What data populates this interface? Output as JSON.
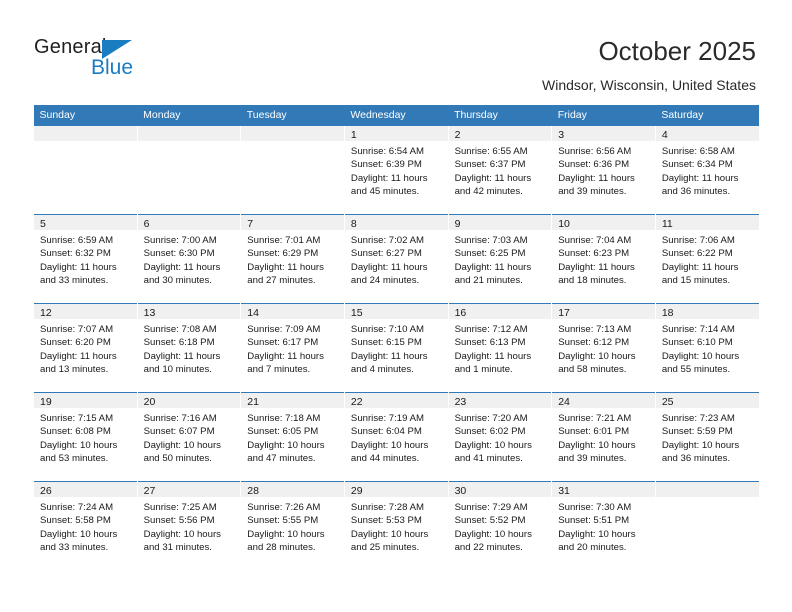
{
  "logo": {
    "word_dark": "General",
    "word_blue": "Blue",
    "triangle_color": "#1b7dc1"
  },
  "header": {
    "title": "October 2025",
    "subtitle": "Windsor, Wisconsin, United States",
    "accent_color": "#3279b7",
    "band_color": "#f0f0f0"
  },
  "weekday_headers": [
    "Sunday",
    "Monday",
    "Tuesday",
    "Wednesday",
    "Thursday",
    "Friday",
    "Saturday"
  ],
  "labels": {
    "sunrise_prefix": "Sunrise:",
    "sunset_prefix": "Sunset:",
    "daylight_prefix": "Daylight:"
  },
  "weeks": [
    [
      {
        "day": "",
        "sunrise": "",
        "sunset": "",
        "daylight": "",
        "empty": true
      },
      {
        "day": "",
        "sunrise": "",
        "sunset": "",
        "daylight": "",
        "empty": true
      },
      {
        "day": "",
        "sunrise": "",
        "sunset": "",
        "daylight": "",
        "empty": true
      },
      {
        "day": "1",
        "sunrise": "Sunrise: 6:54 AM",
        "sunset": "Sunset: 6:39 PM",
        "daylight": "Daylight: 11 hours and 45 minutes."
      },
      {
        "day": "2",
        "sunrise": "Sunrise: 6:55 AM",
        "sunset": "Sunset: 6:37 PM",
        "daylight": "Daylight: 11 hours and 42 minutes."
      },
      {
        "day": "3",
        "sunrise": "Sunrise: 6:56 AM",
        "sunset": "Sunset: 6:36 PM",
        "daylight": "Daylight: 11 hours and 39 minutes."
      },
      {
        "day": "4",
        "sunrise": "Sunrise: 6:58 AM",
        "sunset": "Sunset: 6:34 PM",
        "daylight": "Daylight: 11 hours and 36 minutes."
      }
    ],
    [
      {
        "day": "5",
        "sunrise": "Sunrise: 6:59 AM",
        "sunset": "Sunset: 6:32 PM",
        "daylight": "Daylight: 11 hours and 33 minutes."
      },
      {
        "day": "6",
        "sunrise": "Sunrise: 7:00 AM",
        "sunset": "Sunset: 6:30 PM",
        "daylight": "Daylight: 11 hours and 30 minutes."
      },
      {
        "day": "7",
        "sunrise": "Sunrise: 7:01 AM",
        "sunset": "Sunset: 6:29 PM",
        "daylight": "Daylight: 11 hours and 27 minutes."
      },
      {
        "day": "8",
        "sunrise": "Sunrise: 7:02 AM",
        "sunset": "Sunset: 6:27 PM",
        "daylight": "Daylight: 11 hours and 24 minutes."
      },
      {
        "day": "9",
        "sunrise": "Sunrise: 7:03 AM",
        "sunset": "Sunset: 6:25 PM",
        "daylight": "Daylight: 11 hours and 21 minutes."
      },
      {
        "day": "10",
        "sunrise": "Sunrise: 7:04 AM",
        "sunset": "Sunset: 6:23 PM",
        "daylight": "Daylight: 11 hours and 18 minutes."
      },
      {
        "day": "11",
        "sunrise": "Sunrise: 7:06 AM",
        "sunset": "Sunset: 6:22 PM",
        "daylight": "Daylight: 11 hours and 15 minutes."
      }
    ],
    [
      {
        "day": "12",
        "sunrise": "Sunrise: 7:07 AM",
        "sunset": "Sunset: 6:20 PM",
        "daylight": "Daylight: 11 hours and 13 minutes."
      },
      {
        "day": "13",
        "sunrise": "Sunrise: 7:08 AM",
        "sunset": "Sunset: 6:18 PM",
        "daylight": "Daylight: 11 hours and 10 minutes."
      },
      {
        "day": "14",
        "sunrise": "Sunrise: 7:09 AM",
        "sunset": "Sunset: 6:17 PM",
        "daylight": "Daylight: 11 hours and 7 minutes."
      },
      {
        "day": "15",
        "sunrise": "Sunrise: 7:10 AM",
        "sunset": "Sunset: 6:15 PM",
        "daylight": "Daylight: 11 hours and 4 minutes."
      },
      {
        "day": "16",
        "sunrise": "Sunrise: 7:12 AM",
        "sunset": "Sunset: 6:13 PM",
        "daylight": "Daylight: 11 hours and 1 minute."
      },
      {
        "day": "17",
        "sunrise": "Sunrise: 7:13 AM",
        "sunset": "Sunset: 6:12 PM",
        "daylight": "Daylight: 10 hours and 58 minutes."
      },
      {
        "day": "18",
        "sunrise": "Sunrise: 7:14 AM",
        "sunset": "Sunset: 6:10 PM",
        "daylight": "Daylight: 10 hours and 55 minutes."
      }
    ],
    [
      {
        "day": "19",
        "sunrise": "Sunrise: 7:15 AM",
        "sunset": "Sunset: 6:08 PM",
        "daylight": "Daylight: 10 hours and 53 minutes."
      },
      {
        "day": "20",
        "sunrise": "Sunrise: 7:16 AM",
        "sunset": "Sunset: 6:07 PM",
        "daylight": "Daylight: 10 hours and 50 minutes."
      },
      {
        "day": "21",
        "sunrise": "Sunrise: 7:18 AM",
        "sunset": "Sunset: 6:05 PM",
        "daylight": "Daylight: 10 hours and 47 minutes."
      },
      {
        "day": "22",
        "sunrise": "Sunrise: 7:19 AM",
        "sunset": "Sunset: 6:04 PM",
        "daylight": "Daylight: 10 hours and 44 minutes."
      },
      {
        "day": "23",
        "sunrise": "Sunrise: 7:20 AM",
        "sunset": "Sunset: 6:02 PM",
        "daylight": "Daylight: 10 hours and 41 minutes."
      },
      {
        "day": "24",
        "sunrise": "Sunrise: 7:21 AM",
        "sunset": "Sunset: 6:01 PM",
        "daylight": "Daylight: 10 hours and 39 minutes."
      },
      {
        "day": "25",
        "sunrise": "Sunrise: 7:23 AM",
        "sunset": "Sunset: 5:59 PM",
        "daylight": "Daylight: 10 hours and 36 minutes."
      }
    ],
    [
      {
        "day": "26",
        "sunrise": "Sunrise: 7:24 AM",
        "sunset": "Sunset: 5:58 PM",
        "daylight": "Daylight: 10 hours and 33 minutes."
      },
      {
        "day": "27",
        "sunrise": "Sunrise: 7:25 AM",
        "sunset": "Sunset: 5:56 PM",
        "daylight": "Daylight: 10 hours and 31 minutes."
      },
      {
        "day": "28",
        "sunrise": "Sunrise: 7:26 AM",
        "sunset": "Sunset: 5:55 PM",
        "daylight": "Daylight: 10 hours and 28 minutes."
      },
      {
        "day": "29",
        "sunrise": "Sunrise: 7:28 AM",
        "sunset": "Sunset: 5:53 PM",
        "daylight": "Daylight: 10 hours and 25 minutes."
      },
      {
        "day": "30",
        "sunrise": "Sunrise: 7:29 AM",
        "sunset": "Sunset: 5:52 PM",
        "daylight": "Daylight: 10 hours and 22 minutes."
      },
      {
        "day": "31",
        "sunrise": "Sunrise: 7:30 AM",
        "sunset": "Sunset: 5:51 PM",
        "daylight": "Daylight: 10 hours and 20 minutes."
      },
      {
        "day": "",
        "sunrise": "",
        "sunset": "",
        "daylight": "",
        "empty": true
      }
    ]
  ]
}
